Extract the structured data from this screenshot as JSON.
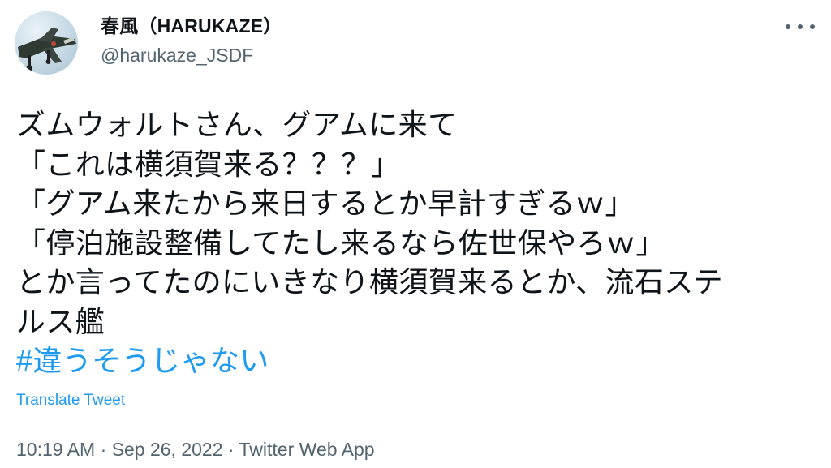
{
  "user": {
    "display_name": "春風（HARUKAZE）",
    "handle": "@harukaze_JSDF"
  },
  "tweet": {
    "lines": [
      "ズムウォルトさん、グアムに来て",
      "「これは横須賀来る？？？」",
      "「グアム来たから来日するとか早計すぎるｗ」",
      "「停泊施設整備してたし来るなら佐世保やろｗ」",
      "とか言ってたのにいきなり横須賀来るとか、流石ステ",
      "ルス艦"
    ],
    "hashtag": "#違うそうじゃない"
  },
  "translate_label": "Translate Tweet",
  "timestamp": {
    "time": "10:19 AM",
    "date": "Sep 26, 2022",
    "source": "Twitter Web App",
    "separator": "·"
  },
  "icons": {
    "more": "more-horizontal-icon"
  },
  "colors": {
    "link": "#1d9bf0",
    "secondary": "#536471",
    "text": "#0f1419"
  }
}
